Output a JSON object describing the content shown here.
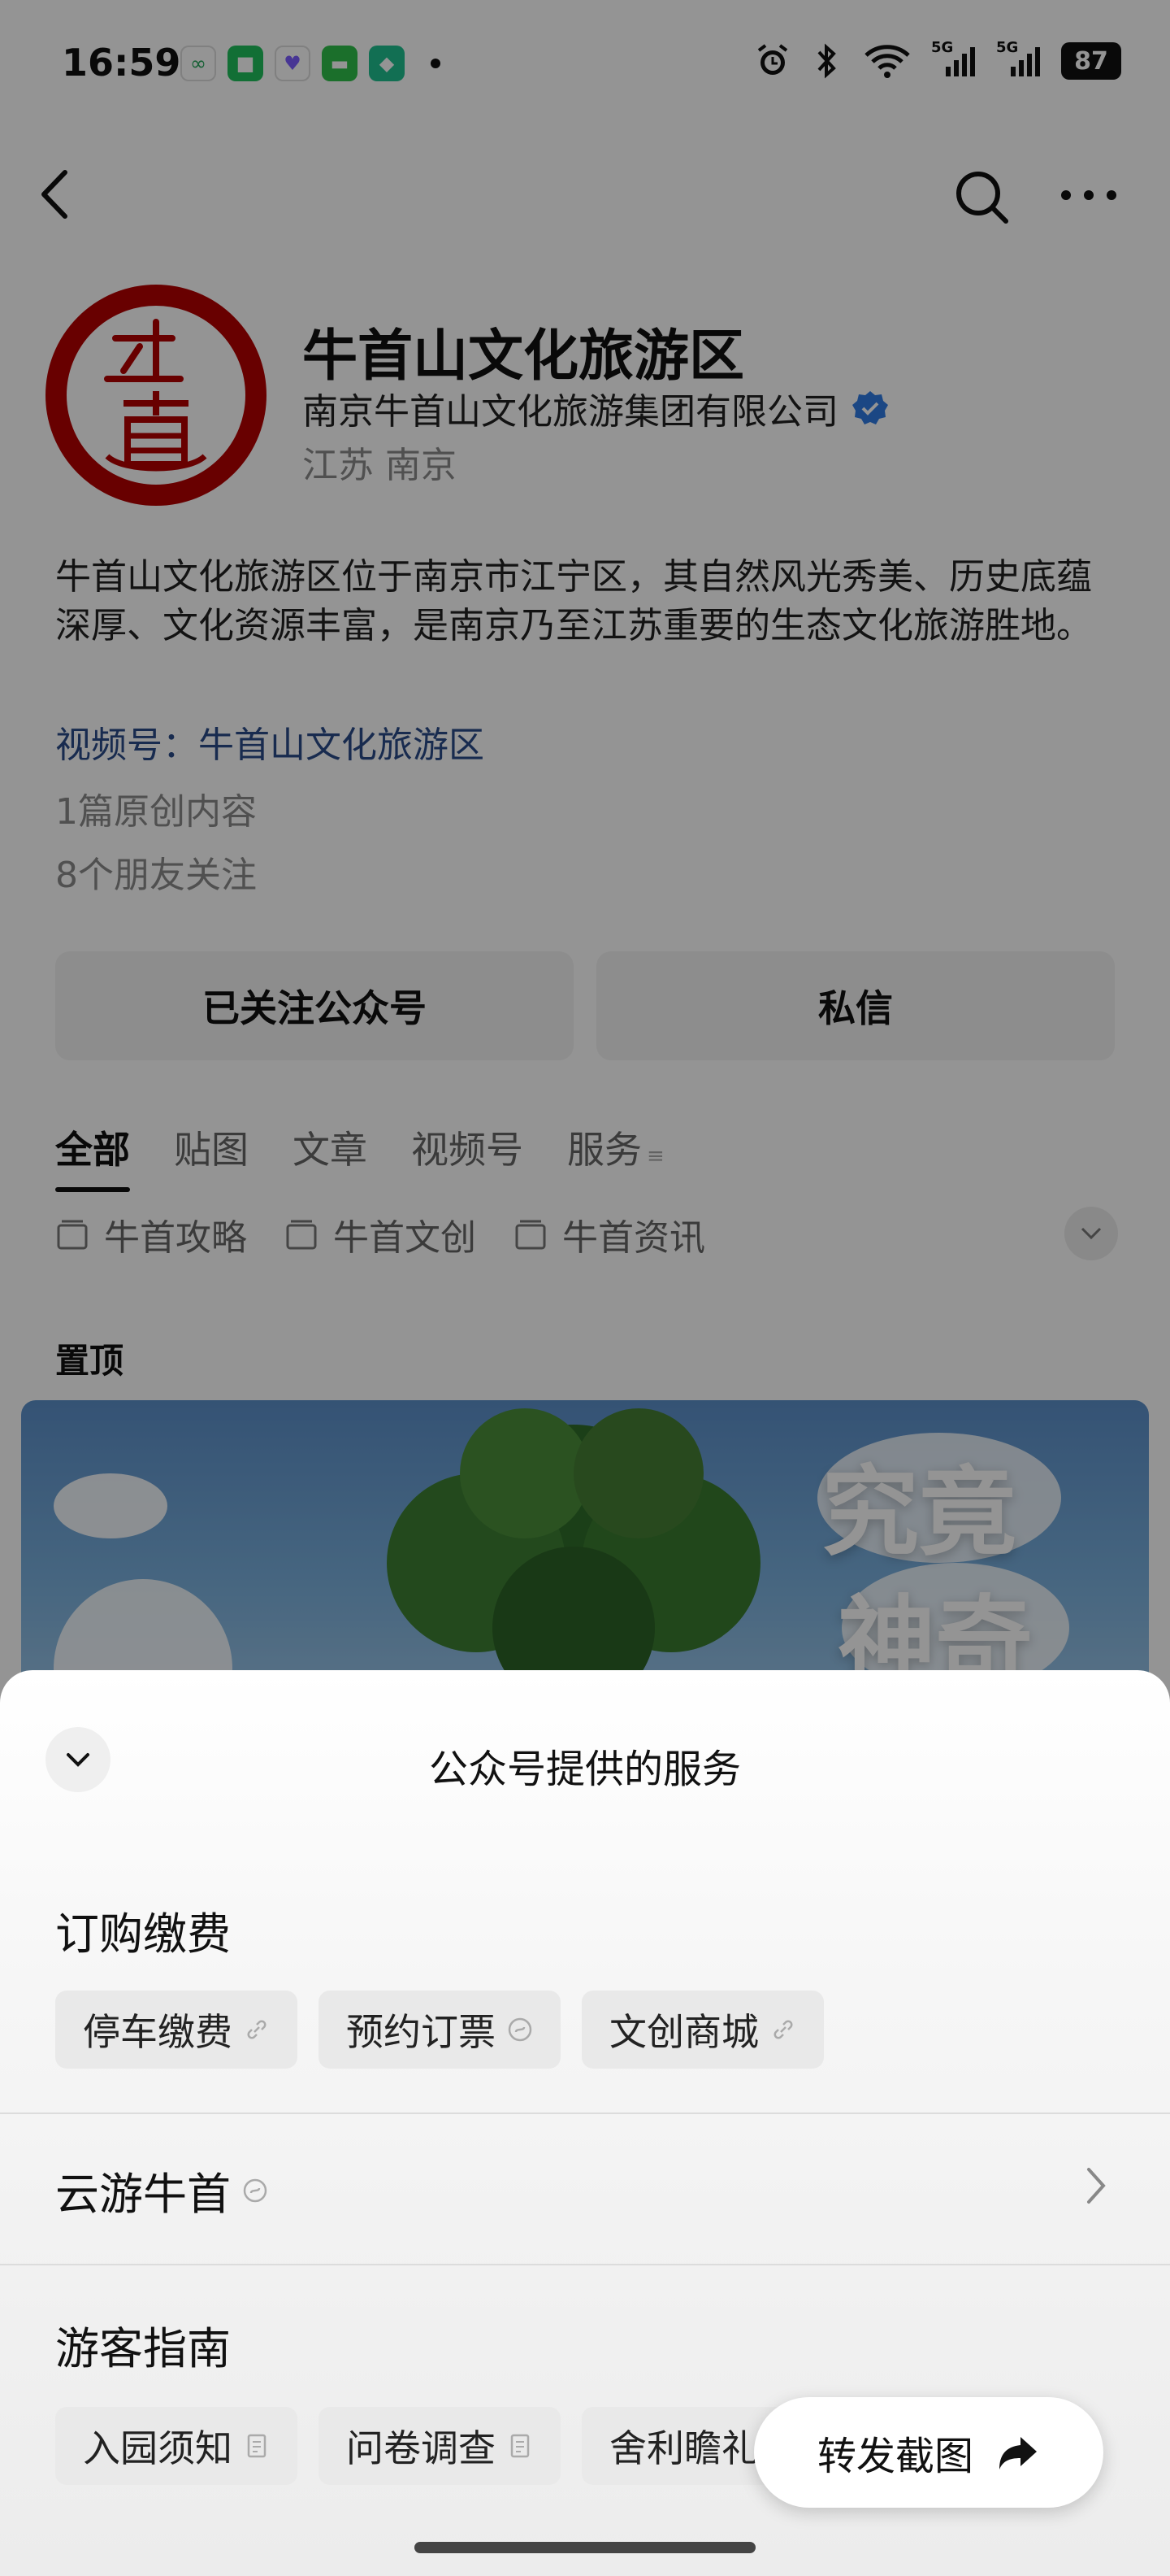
{
  "status_bar": {
    "time": "16:59",
    "battery": "87",
    "signal_label_1": "5G",
    "signal_label_2": "5G"
  },
  "profile": {
    "title": "牛首山文化旅游区",
    "company": "南京牛首山文化旅游集团有限公司",
    "location": "江苏 南京",
    "description": "牛首山文化旅游区位于南京市江宁区，其自然风光秀美、历史底蕴深厚、文化资源丰富，是南京乃至江苏重要的生态文化旅游胜地。",
    "channel": "视频号：牛首山文化旅游区",
    "original_count": "1篇原创内容",
    "friends_following": "8个朋友关注",
    "verified_color": "#2f7be3"
  },
  "actions": {
    "follow_label": "已关注公众号",
    "message_label": "私信"
  },
  "tabs": [
    "全部",
    "贴图",
    "文章",
    "视频号",
    "服务"
  ],
  "subtabs": [
    "牛首攻略",
    "牛首文创",
    "牛首资讯"
  ],
  "pinned_label": "置顶",
  "banner": {
    "right_text_1": "究竟",
    "right_text_2": "神奇"
  },
  "sheet": {
    "title": "公众号提供的服务",
    "sections": [
      {
        "heading": "订购缴费",
        "items": [
          {
            "label": "停车缴费",
            "icon": "link-icon"
          },
          {
            "label": "预约订票",
            "icon": "mini-program-icon"
          },
          {
            "label": "文创商城",
            "icon": "link-icon"
          }
        ]
      },
      {
        "heading": "游客指南",
        "items": [
          {
            "label": "入园须知",
            "icon": "article-icon"
          },
          {
            "label": "问卷调查",
            "icon": "article-icon"
          },
          {
            "label": "舍利瞻礼",
            "icon": "article-icon"
          }
        ]
      }
    ],
    "cloud_tour": "云游牛首",
    "share_label": "转发截图"
  },
  "colors": {
    "brand_red": "#b30000",
    "link_blue": "#2a4a88"
  }
}
